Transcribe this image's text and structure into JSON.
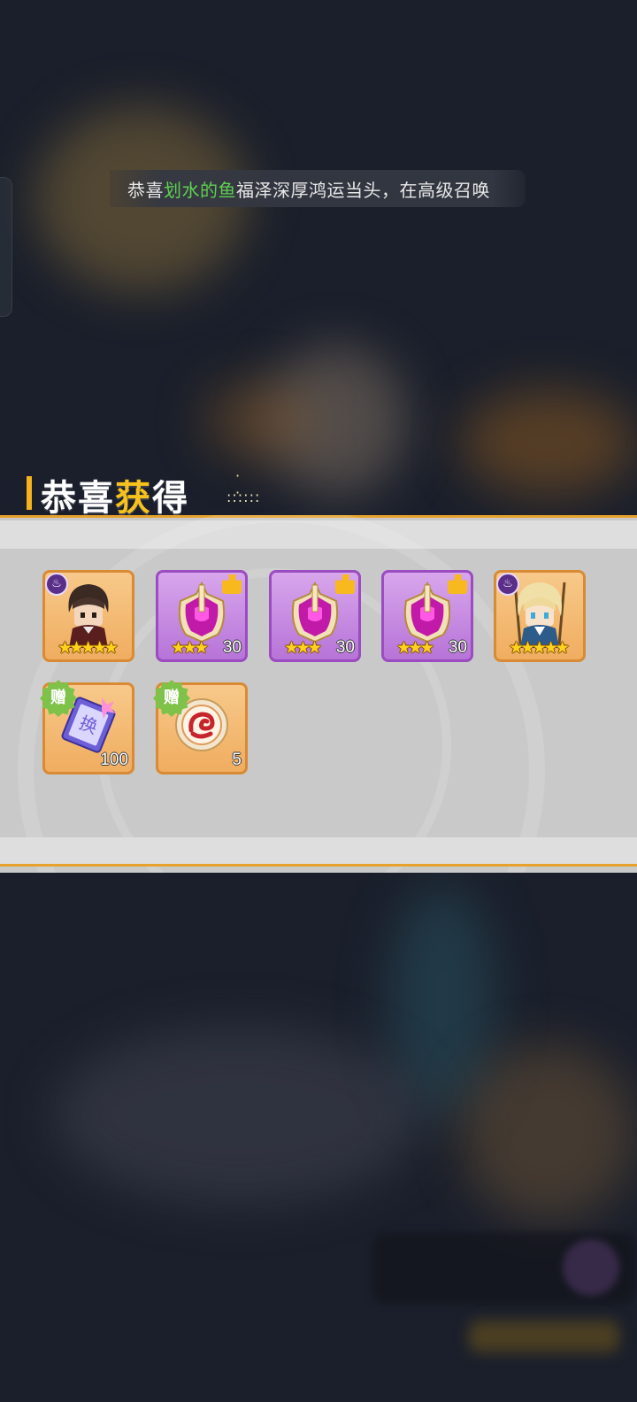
{
  "announcement": {
    "prefix": "恭喜",
    "player_name": "划水的鱼",
    "message": "福泽深厚鸿运当头，在高级召唤"
  },
  "title": {
    "part1": "恭喜",
    "part2": "获",
    "part3": "得"
  },
  "rewards": [
    {
      "kind": "hero",
      "icon": "hero-portrait-dark-hair",
      "badge": "element-fire-icon",
      "stars": "★★★★★",
      "star_count": 5,
      "count": ""
    },
    {
      "kind": "hero-fragment",
      "icon": "purple-helmet-icon",
      "badge": "fragment-piece-icon",
      "stars": "★★★",
      "star_count": 3,
      "count": "30"
    },
    {
      "kind": "hero-fragment",
      "icon": "purple-helmet-icon",
      "badge": "fragment-piece-icon",
      "stars": "★★★",
      "star_count": 3,
      "count": "30"
    },
    {
      "kind": "hero-fragment",
      "icon": "purple-helmet-icon",
      "badge": "fragment-piece-icon",
      "stars": "★★★",
      "star_count": 3,
      "count": "30"
    },
    {
      "kind": "hero",
      "icon": "hero-portrait-blonde",
      "badge": "element-fire-icon",
      "stars": "★★★★★",
      "star_count": 5,
      "count": ""
    },
    {
      "kind": "gift",
      "icon": "exchange-ticket-icon",
      "badge_text": "赠",
      "ticket_text": "换",
      "count": "100"
    },
    {
      "kind": "gift",
      "icon": "dragon-coin-icon",
      "badge_text": "赠",
      "count": "5"
    }
  ],
  "colors": {
    "accent_gold": "#f7c21d",
    "player_name_green": "#5fcf52",
    "orange_card": "#f0ad60",
    "purple_card": "#b774d8",
    "gift_badge_green": "#7fc24a"
  }
}
